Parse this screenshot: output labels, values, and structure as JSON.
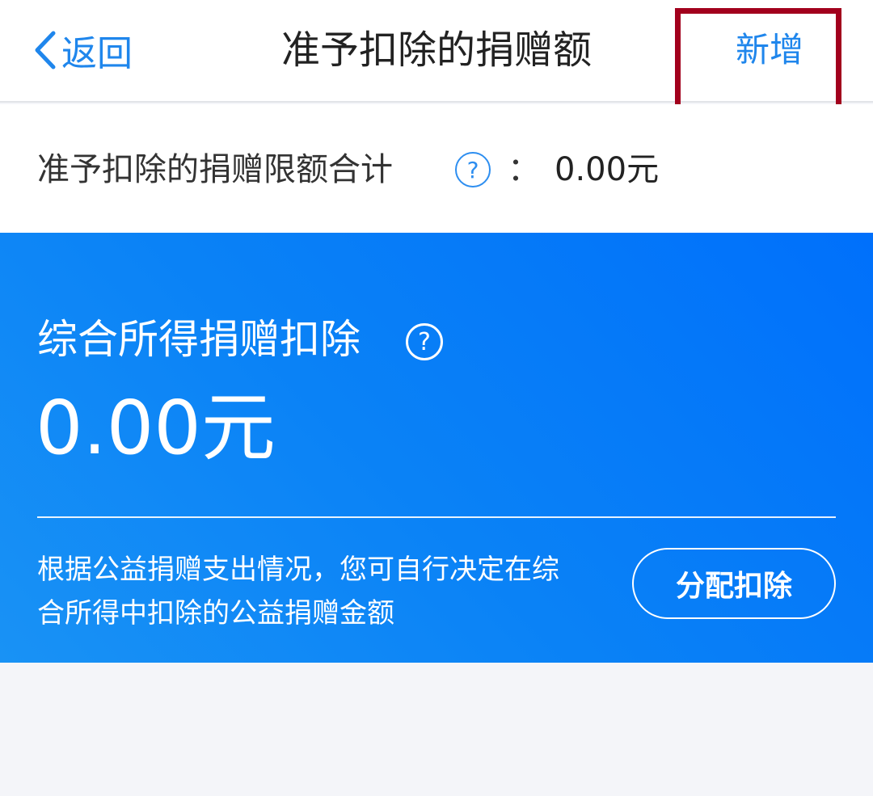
{
  "nav": {
    "back_label": "返回",
    "title": "准予扣除的捐赠额",
    "add_label": "新增"
  },
  "limit": {
    "label": "准予扣除的捐赠限额合计",
    "help_icon": "question-circle-icon",
    "colon": "：",
    "value": "0.00元"
  },
  "card": {
    "title": "综合所得捐赠扣除",
    "help_icon": "question-circle-icon",
    "amount": "0.00元",
    "description_lines": [
      "根据公益捐赠支出情况，您可自行决定在综",
      "合所得中扣除的公益捐赠金额"
    ],
    "button_label": "分配扣除"
  },
  "icons": {
    "back": "chevron-left-icon",
    "question_glyph": "?"
  },
  "colors": {
    "accent": "#1f86ec",
    "highlight_border": "#a2001d",
    "card_gradient_start": "#0070fb",
    "card_gradient_end": "#1992f5",
    "page_background": "#f4f5f9"
  }
}
